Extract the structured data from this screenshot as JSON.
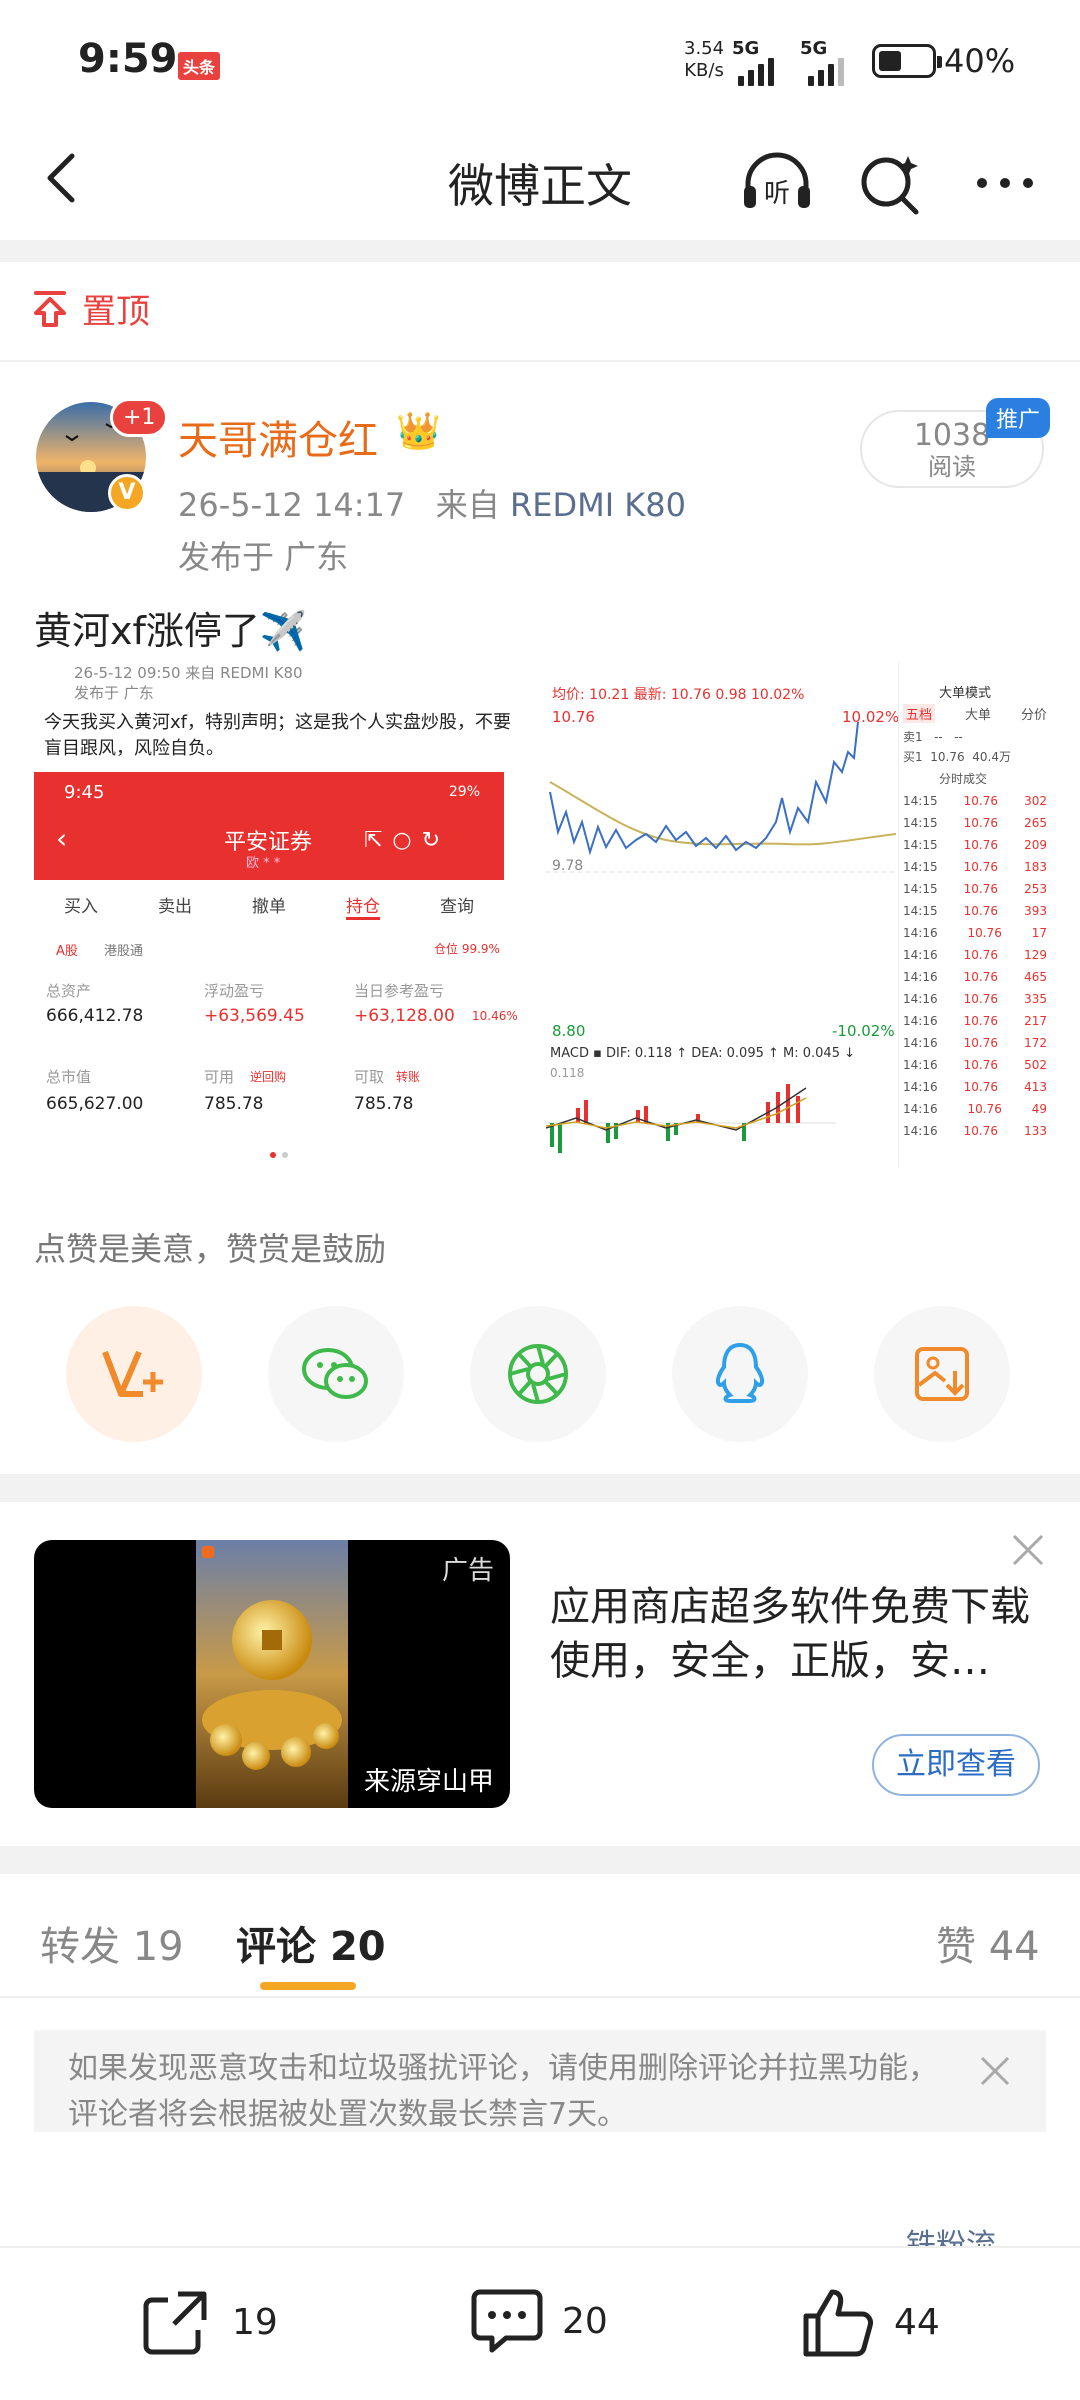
{
  "status_bar": {
    "time": "9:59",
    "toutiao_badge": "头条",
    "net_speed_value": "3.54",
    "net_speed_unit": "KB/s",
    "sim1": "5G",
    "sim2": "5G",
    "battery": "40%"
  },
  "nav": {
    "title": "微博正文",
    "back_icon": "chevron-left-icon",
    "listen_label": "听"
  },
  "pin": {
    "label": "置顶"
  },
  "post": {
    "author": "天哥满仓红",
    "avatar_badge": "+1",
    "verified": "V",
    "time": "26-5-12 14:17",
    "from_label": "来自",
    "device": "REDMI K80",
    "location": "发布于 广东",
    "reads": "1038",
    "reads_label": "阅读",
    "promo_tag": "推广",
    "text": "黄河xf涨停了✈️"
  },
  "image1": {
    "header": "26-5-12 09:50  来自 REDMI K80",
    "header2": "发布于 广东",
    "body": "今天我买入黄河xf，特别声明；这是我个人实盘炒股，不要盲目跟风，风险自负。",
    "phone_time": "9:45",
    "phone_battery": "29%",
    "broker": "平安证券",
    "account_hint": "欧 * *",
    "tabs": [
      "买入",
      "卖出",
      "撤单",
      "持仓",
      "查询"
    ],
    "sub_a": "A股",
    "sub_b": "港股通",
    "position_pct": "仓位 99.9%",
    "total_assets_label": "总资产",
    "total_assets": "666,412.78",
    "float_pnl_label": "浮动盈亏",
    "float_pnl": "+63,569.45",
    "today_pnl_label": "当日参考盈亏",
    "today_pnl": "+63,128.00",
    "today_pct": "10.46%",
    "market_value_label": "总市值",
    "market_value": "665,627.00",
    "available_label": "可用",
    "available": "785.78",
    "transfer_label": "逆回购",
    "withdrawable_label": "可取",
    "withdrawable": "785.78",
    "transfer2_label": "转账"
  },
  "image2": {
    "header": "均价: 10.21  最新: 10.76  0.98  10.02%",
    "price_top": "10.76",
    "pct_top": "10.02%",
    "price_mid": "9.78",
    "price_bottom": "8.80",
    "pct_bottom": "-10.02%",
    "macd": "MACD ▪ DIF: 0.118 ↑   DEA: 0.095 ↑  M: 0.045 ↓",
    "macd_val": "0.118",
    "mode": "大单模式",
    "book_tabs": [
      "五档",
      "大单",
      "分价"
    ],
    "sell1": "卖1   --   --",
    "buy1": "买1  10.76  40.4万",
    "ticks_title": "分时成交",
    "ticks": [
      {
        "t": "14:15",
        "p": "10.76",
        "v": "302"
      },
      {
        "t": "14:15",
        "p": "10.76",
        "v": "265"
      },
      {
        "t": "14:15",
        "p": "10.76",
        "v": "209"
      },
      {
        "t": "14:15",
        "p": "10.76",
        "v": "183"
      },
      {
        "t": "14:15",
        "p": "10.76",
        "v": "253"
      },
      {
        "t": "14:15",
        "p": "10.76",
        "v": "393"
      },
      {
        "t": "14:16",
        "p": "10.76",
        "v": "17"
      },
      {
        "t": "14:16",
        "p": "10.76",
        "v": "129"
      },
      {
        "t": "14:16",
        "p": "10.76",
        "v": "465"
      },
      {
        "t": "14:16",
        "p": "10.76",
        "v": "335"
      },
      {
        "t": "14:16",
        "p": "10.76",
        "v": "217"
      },
      {
        "t": "14:16",
        "p": "10.76",
        "v": "172"
      },
      {
        "t": "14:16",
        "p": "10.76",
        "v": "502"
      },
      {
        "t": "14:16",
        "p": "10.76",
        "v": "413"
      },
      {
        "t": "14:16",
        "p": "10.76",
        "v": "49"
      },
      {
        "t": "14:16",
        "p": "10.76",
        "v": "133"
      }
    ]
  },
  "reward_hint": "点赞是美意，赞赏是鼓励",
  "share_buttons": [
    "v-plus-icon",
    "wechat-icon",
    "moments-icon",
    "qq-icon",
    "save-image-icon"
  ],
  "ad": {
    "badge": "广告",
    "source": "来源穿山甲",
    "text": "应用商店超多软件免费下载使用，安全，正版，安…",
    "button": "立即查看"
  },
  "tabs": {
    "repost_label": "转发",
    "repost_count": "19",
    "comment_label": "评论",
    "comment_count": "20",
    "like_label": "赞",
    "like_count": "44"
  },
  "notice": "如果发现恶意攻击和垃圾骚扰评论，请使用删除评论并拉黑功能，评论者将会根据被处置次数最长禁言7天。",
  "fans_link": "铁粉流",
  "bottom": {
    "repost": "19",
    "comment": "20",
    "like": "44"
  },
  "colors": {
    "accent_orange": "#e86b1a",
    "red": "#e8413e",
    "link_blue": "#5a6f8f",
    "tab_underline": "#f5a623"
  }
}
